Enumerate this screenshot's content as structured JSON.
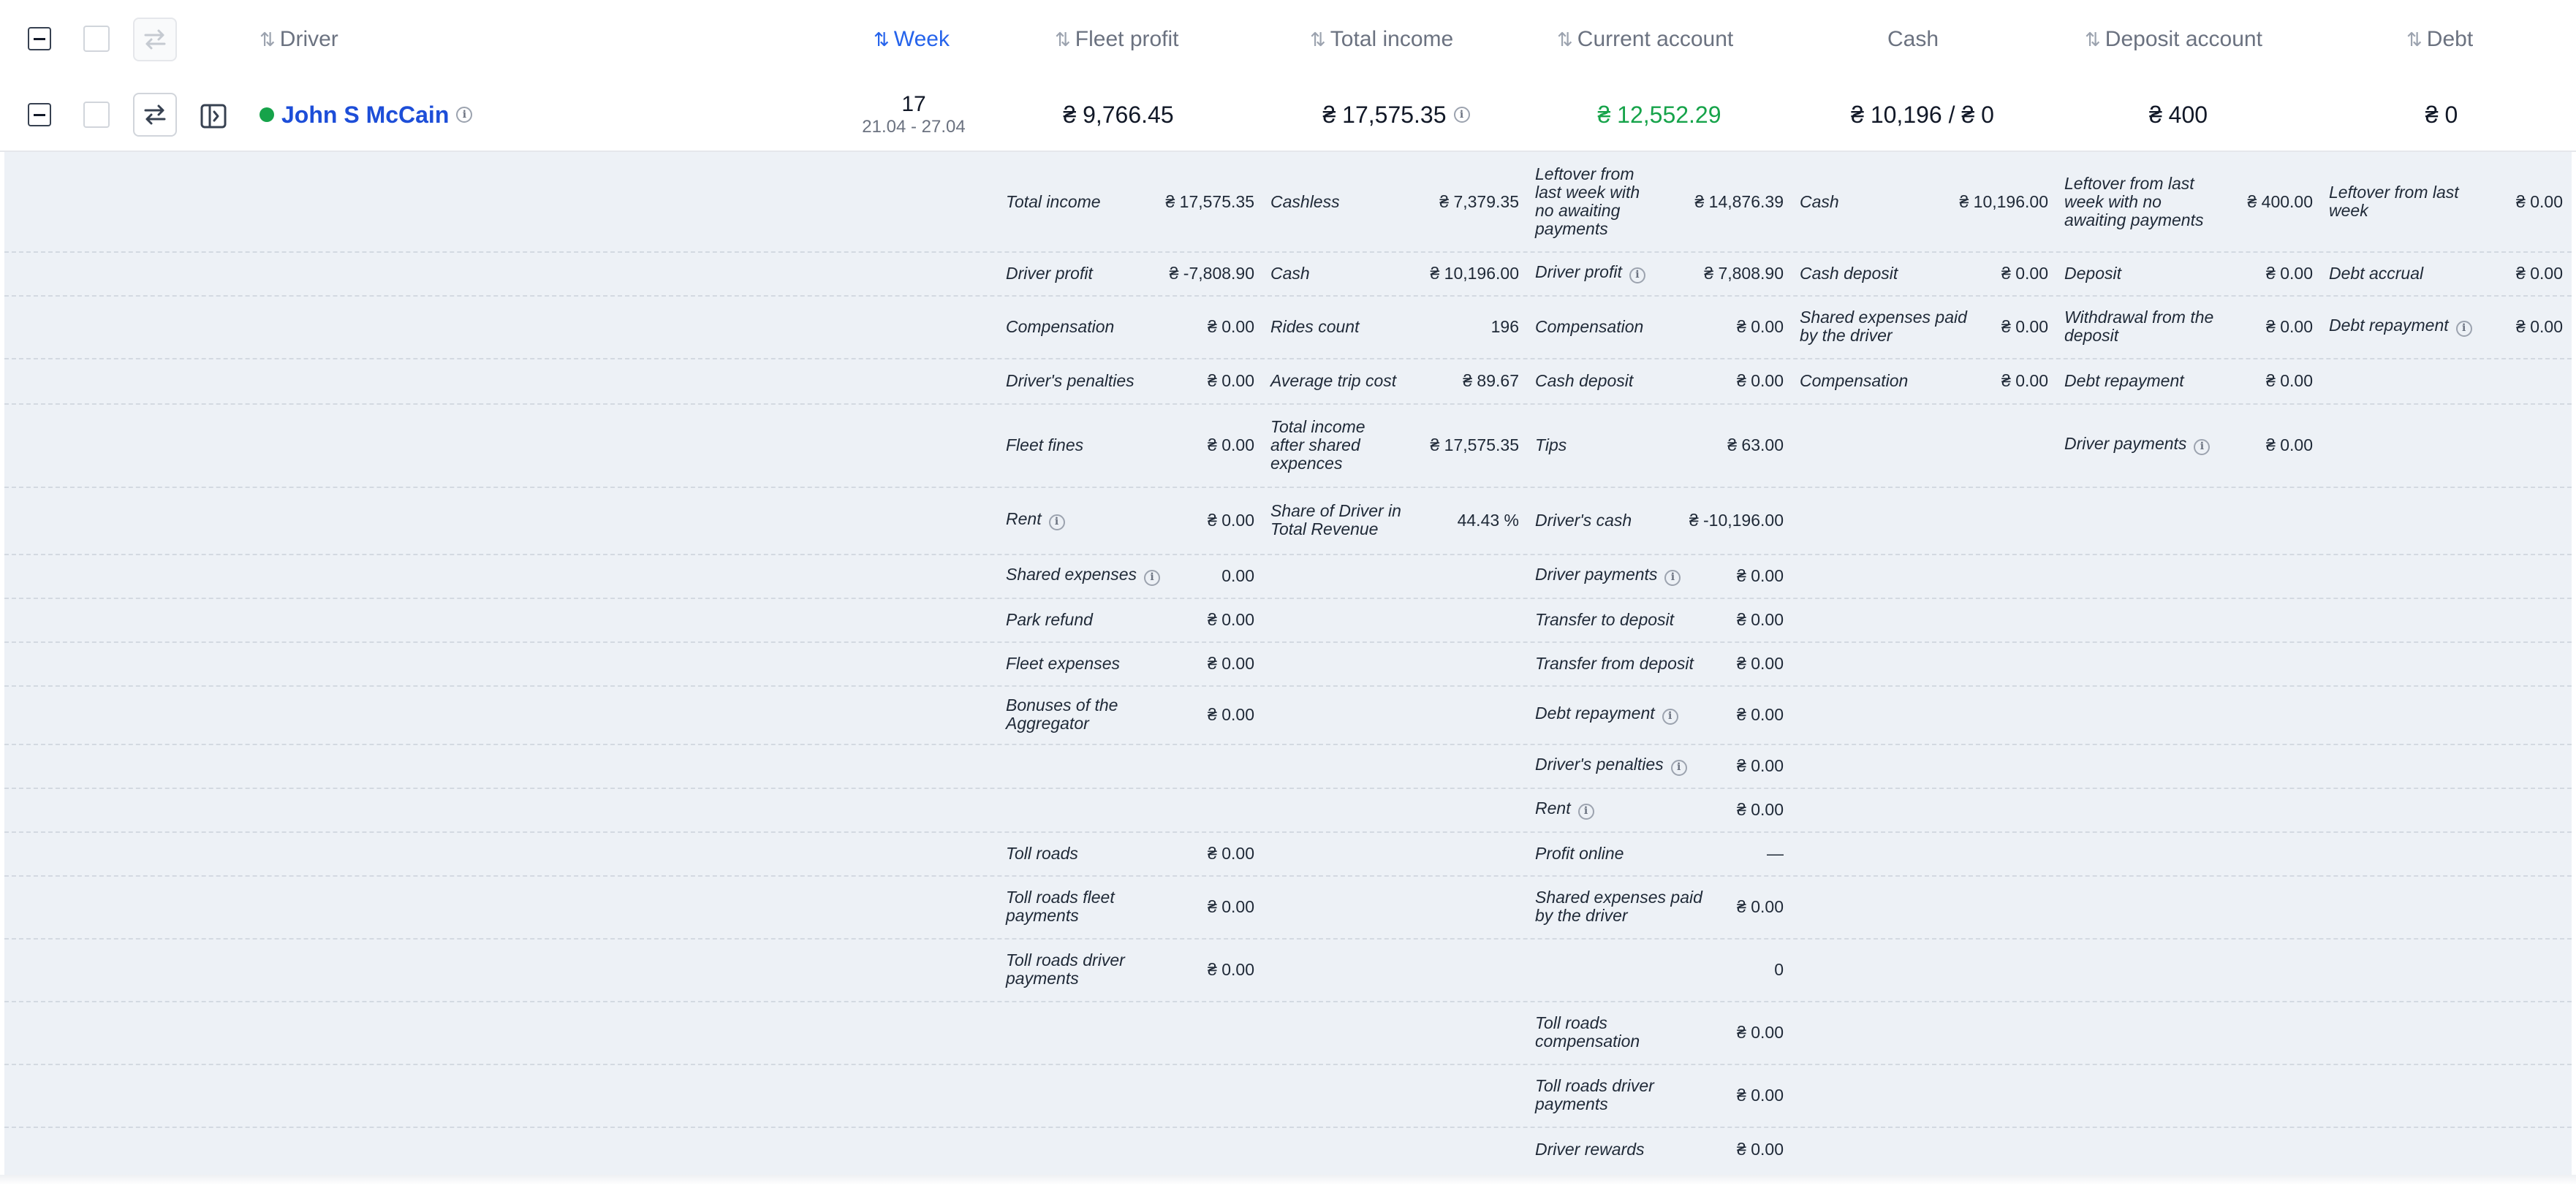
{
  "header": {
    "driver": "Driver",
    "week": "Week",
    "fleet_profit": "Fleet profit",
    "total_income": "Total income",
    "current_account": "Current account",
    "cash": "Cash",
    "deposit_account": "Deposit account",
    "debt": "Debt"
  },
  "row": {
    "driver_name": "John S McCain",
    "week_number": "17",
    "week_range": "21.04 - 27.04",
    "fleet_profit": "₴ 9,766.45",
    "total_income": "₴ 17,575.35",
    "current_account": "₴ 12,552.29",
    "cash": "₴ 10,196  /  ₴ 0",
    "deposit_account": "₴ 400",
    "debt": "₴ 0"
  },
  "colors": {
    "accent": "#2563eb",
    "positive": "#16a34a",
    "status_online": "#16a34a",
    "detail_bg": "#edf1f6"
  },
  "detail": {
    "c1": {
      "total_income": {
        "label": "Total income",
        "value": "₴ 17,575.35"
      },
      "driver_profit": {
        "label": "Driver profit",
        "value": "₴ -7,808.90"
      },
      "compensation": {
        "label": "Compensation",
        "value": "₴ 0.00"
      },
      "drivers_penalties": {
        "label": "Driver's penalties",
        "value": "₴ 0.00"
      },
      "fleet_fines": {
        "label": "Fleet fines",
        "value": "₴ 0.00"
      },
      "rent": {
        "label": "Rent",
        "value": "₴ 0.00"
      },
      "shared_expenses": {
        "label": "Shared expenses",
        "value": "0.00"
      },
      "park_refund": {
        "label": "Park refund",
        "value": "₴ 0.00"
      },
      "fleet_expenses": {
        "label": "Fleet expenses",
        "value": "₴ 0.00"
      },
      "bonuses": {
        "label": "Bonuses of the Aggregator",
        "value": "₴ 0.00"
      },
      "toll_roads": {
        "label": "Toll roads",
        "value": "₴ 0.00"
      },
      "toll_roads_fleet": {
        "label": "Toll roads fleet payments",
        "value": "₴ 0.00"
      },
      "toll_roads_driver": {
        "label": "Toll roads driver payments",
        "value": "₴ 0.00"
      }
    },
    "c2": {
      "cashless": {
        "label": "Cashless",
        "value": "₴ 7,379.35"
      },
      "cash": {
        "label": "Cash",
        "value": "₴ 10,196.00"
      },
      "rides_count": {
        "label": "Rides count",
        "value": "196"
      },
      "avg_trip_cost": {
        "label": "Average trip cost",
        "value": "₴ 89.67"
      },
      "income_after_shared": {
        "label": "Total income after shared expences",
        "value": "₴ 17,575.35"
      },
      "share_of_driver": {
        "label": "Share of Driver in Total Revenue",
        "value": "44.43 %"
      }
    },
    "c3": {
      "leftover": {
        "label": "Leftover from last week with no awaiting payments",
        "value": "₴ 14,876.39"
      },
      "driver_profit": {
        "label": "Driver profit",
        "value": "₴ 7,808.90"
      },
      "compensation": {
        "label": "Compensation",
        "value": "₴ 0.00"
      },
      "cash_deposit": {
        "label": "Cash deposit",
        "value": "₴ 0.00"
      },
      "tips": {
        "label": "Tips",
        "value": "₴ 63.00"
      },
      "drivers_cash": {
        "label": "Driver's cash",
        "value": "₴ -10,196.00"
      },
      "driver_payments": {
        "label": "Driver payments",
        "value": "₴ 0.00"
      },
      "transfer_to_deposit": {
        "label": "Transfer to deposit",
        "value": "₴ 0.00"
      },
      "transfer_from_deposit": {
        "label": "Transfer from deposit",
        "value": "₴ 0.00"
      },
      "debt_repayment": {
        "label": "Debt repayment",
        "value": "₴ 0.00"
      },
      "drivers_penalties": {
        "label": "Driver's penalties",
        "value": "₴ 0.00"
      },
      "rent": {
        "label": "Rent",
        "value": "₴ 0.00"
      },
      "profit_online": {
        "label": "Profit online",
        "value": "—"
      },
      "shared_expenses_paid": {
        "label": "Shared expenses paid by the driver",
        "value": "₴ 0.00"
      },
      "blank_row_value": {
        "label": "",
        "value": "0"
      },
      "toll_roads_compensation": {
        "label": "Toll roads compensation",
        "value": "₴ 0.00"
      },
      "toll_roads_driver_payments": {
        "label": "Toll roads driver payments",
        "value": "₴ 0.00"
      },
      "driver_rewards": {
        "label": "Driver rewards",
        "value": "₴ 0.00"
      }
    },
    "c4": {
      "cash": {
        "label": "Cash",
        "value": "₴ 10,196.00"
      },
      "cash_deposit": {
        "label": "Cash deposit",
        "value": "₴ 0.00"
      },
      "shared_expenses_paid": {
        "label": "Shared expenses paid by the driver",
        "value": "₴ 0.00"
      },
      "compensation": {
        "label": "Compensation",
        "value": "₴ 0.00"
      }
    },
    "c5": {
      "leftover": {
        "label": "Leftover from last week with no awaiting payments",
        "value": "₴ 400.00"
      },
      "deposit": {
        "label": "Deposit",
        "value": "₴ 0.00"
      },
      "withdrawal": {
        "label": "Withdrawal from the deposit",
        "value": "₴ 0.00"
      },
      "debt_repayment": {
        "label": "Debt repayment",
        "value": "₴ 0.00"
      },
      "driver_payments": {
        "label": "Driver payments",
        "value": "₴ 0.00"
      }
    },
    "c6": {
      "leftover": {
        "label": "Leftover from last week",
        "value": "₴ 0.00"
      },
      "debt_accrual": {
        "label": "Debt accrual",
        "value": "₴ 0.00"
      },
      "debt_repayment": {
        "label": "Debt repayment",
        "value": "₴ 0.00"
      }
    }
  }
}
